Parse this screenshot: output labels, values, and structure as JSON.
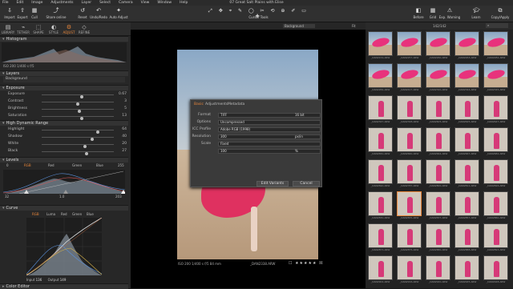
{
  "menu": [
    "File",
    "Edit",
    "Image",
    "Adjustments",
    "Layer",
    "Select",
    "Camera",
    "View",
    "Window",
    "Help"
  ],
  "window_title": "07 Great Salt Plains with Elise",
  "toolbar": {
    "left": [
      "Import",
      "Export",
      "Cull",
      "Share online"
    ],
    "mid": [
      "Reset",
      "Undo/Redo",
      "Auto Adjust"
    ],
    "cursor_tools": "Cursor Tools",
    "right": [
      "Before",
      "Grid",
      "Exp. Warning",
      "Learn",
      "Copy/Apply"
    ]
  },
  "tool_tabs": [
    "LIBRARY",
    "TETHER",
    "SHAPE",
    "STYLE",
    "ADJUST",
    "REFINE"
  ],
  "active_tool_tab": "ADJUST",
  "panels": {
    "histogram": "Histogram",
    "hist_info": "ISO 200   1/400 s   f/5",
    "layers": "Layers",
    "background": "Background",
    "exposure": "Exposure",
    "exposure_rows": [
      {
        "label": "Exposure",
        "value": "0.67",
        "pos": 0.55
      },
      {
        "label": "Contrast",
        "value": "3",
        "pos": 0.5
      },
      {
        "label": "Brightness",
        "value": "5",
        "pos": 0.52
      },
      {
        "label": "Saturation",
        "value": "13",
        "pos": 0.56
      }
    ],
    "hdr": "High Dynamic Range",
    "hdr_rows": [
      {
        "label": "Highlight",
        "value": "64",
        "pos": 0.78
      },
      {
        "label": "Shadow",
        "value": "40",
        "pos": 0.7
      },
      {
        "label": "White",
        "value": "20",
        "pos": 0.6
      },
      {
        "label": "Black",
        "value": "27",
        "pos": 0.62
      }
    ],
    "levels": "Levels",
    "levels_tabs": [
      "RGB",
      "Red",
      "Green",
      "Blue"
    ],
    "levels_values": [
      "0",
      "255",
      "32",
      "1.0",
      "203"
    ],
    "curve": "Curve",
    "curve_tabs": [
      "RGB",
      "Luma",
      "Red",
      "Green",
      "Blue"
    ],
    "curve_io": {
      "input_label": "Input",
      "input": "136",
      "output_label": "Output",
      "output": "149"
    },
    "color_editor": "Color Editor"
  },
  "viewer": {
    "variant": "Background",
    "footer": "ISO 200   1/400 s   f/5   84 mm",
    "filename": "_DAN2338.ARW",
    "fit": "Fit"
  },
  "dialog": {
    "tabs": [
      "Basic",
      "Adjustments",
      "Metadata"
    ],
    "rows": [
      {
        "label": "Format",
        "value": "TIFF",
        "extra": "16 bit"
      },
      {
        "label": "Options",
        "value": "Uncompressed"
      },
      {
        "label": "ICC Profile",
        "value": "Adobe RGB (1998)"
      },
      {
        "label": "Resolution",
        "value": "300",
        "extra": "px/in"
      },
      {
        "label": "Scale",
        "value": "Fixed"
      },
      {
        "label": "",
        "value": "100",
        "extra": "%"
      }
    ],
    "buttons": [
      "Edit Variants",
      "Cancel"
    ]
  },
  "browser": {
    "count": "142/142",
    "filenames": [
      "_DAN2219.ARW",
      "_DAN2257.ARW",
      "_DAN2260.ARW",
      "_DAN2263.ARW",
      "_DAN2282.ARW",
      "_DAN2284.ARW",
      "_DAN2417.ARW",
      "_DAN2320.ARW",
      "_DAN2344.ARW",
      "_DAN2345.ARW",
      "_DAN2347.ARW",
      "_DAN2348.ARW",
      "_DAN2605.ARW",
      "_DAN2625.ARW",
      "_DAN2647.ARW",
      "_DAN2650.ARW",
      "_DAN2660.ARW",
      "_DAN2664.ARW",
      "_DAN2667.ARW",
      "_DAN2682.ARW",
      "_DAN2690.ARW",
      "_DAN2787.ARW",
      "_DAN2800.ARW",
      "_DAN2811.ARW",
      "_DAN2826.ARW",
      "_DAN2830.ARW",
      "_DAN2835.ARW",
      "_DAN2837.ARW",
      "_DAN2857.ARW",
      "_DAN2860.ARW",
      "_DAN2873.ARW",
      "_DAN2875.ARW",
      "_DAN2880.ARW",
      "_DAN2888.ARW",
      "_DAN2893.ARW",
      "_DAN2902.ARW",
      "_DAN2916.ARW",
      "_DAN2920.ARW",
      "_DAN2925.ARW",
      "_DAN2928.ARW"
    ]
  }
}
